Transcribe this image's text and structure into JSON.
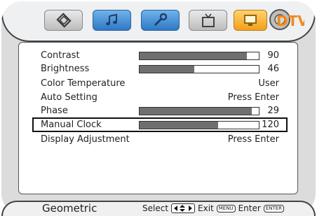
{
  "tabs": [
    {
      "name": "picture-tab",
      "icon": "film-icon",
      "style": "gray"
    },
    {
      "name": "audio-tab",
      "icon": "music-icon",
      "style": "blue"
    },
    {
      "name": "setup-tab",
      "icon": "wrench-icon",
      "style": "blue"
    },
    {
      "name": "tv-tab",
      "icon": "tv-icon",
      "style": "gray"
    },
    {
      "name": "pc-tab",
      "icon": "monitor-icon",
      "style": "orange"
    },
    {
      "name": "dtv-tab",
      "icon": "dtv-logo",
      "style": "logo",
      "text": "DTV"
    }
  ],
  "menu": {
    "items": [
      {
        "label": "Contrast",
        "value": "90",
        "level": 0.9
      },
      {
        "label": "Brightness",
        "value": "46",
        "level": 0.46
      },
      {
        "label": "Color Temperature",
        "value": "User"
      },
      {
        "label": "Auto Setting",
        "value": "Press Enter"
      },
      {
        "label": "Phase",
        "value": "29",
        "level": 0.94
      },
      {
        "label": "Manual Clock",
        "value": "120",
        "level": 0.66,
        "selected": true
      },
      {
        "label": "Display Adjustment",
        "value": "Press Enter"
      }
    ]
  },
  "footer": {
    "page_name": "Geometric",
    "select_label": "Select",
    "exit_label": "Exit",
    "menu_key": "MENU",
    "enter_label": "Enter",
    "enter_key": "ENTER"
  },
  "colors": {
    "frame": "#dcdcdc",
    "bar_fill": "#6f6f6f",
    "blue_tab": "#2f78c5",
    "orange_tab": "#f29f1c"
  }
}
